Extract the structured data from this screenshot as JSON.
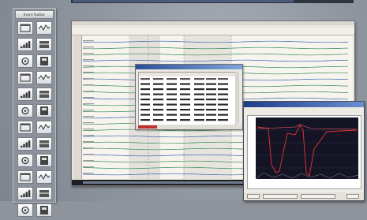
{
  "toolbox": {
    "title": "Event Toolbar",
    "tools": [
      {
        "icon": "window-icon"
      },
      {
        "icon": "waveform-icon"
      },
      {
        "icon": "chart-icon"
      },
      {
        "icon": "sine-icon"
      },
      {
        "icon": "spectrum-icon"
      },
      {
        "icon": "histogram-icon"
      },
      {
        "icon": "bars-icon"
      },
      {
        "icon": "grid-icon"
      },
      {
        "icon": "list-icon"
      },
      {
        "icon": "counter-icon"
      },
      {
        "icon": "panel-icon"
      },
      {
        "icon": "module-icon"
      },
      {
        "icon": "dial-icon"
      },
      {
        "icon": "table-icon"
      },
      {
        "icon": "note-icon"
      },
      {
        "icon": "stack-icon"
      },
      {
        "icon": "text-tool-icon"
      },
      {
        "icon": "form-icon"
      },
      {
        "icon": "equalizer-icon"
      },
      {
        "icon": "keyboard-icon"
      },
      {
        "icon": "trace-icon"
      },
      {
        "icon": "gauge-icon"
      },
      {
        "icon": "camera-icon"
      },
      {
        "icon": "layers-icon"
      }
    ]
  },
  "colors": {
    "trace_green": "#2e8a55",
    "trace_blue": "#2f5fae",
    "spike_red": "#e23535",
    "plot_bg": "#141424"
  }
}
